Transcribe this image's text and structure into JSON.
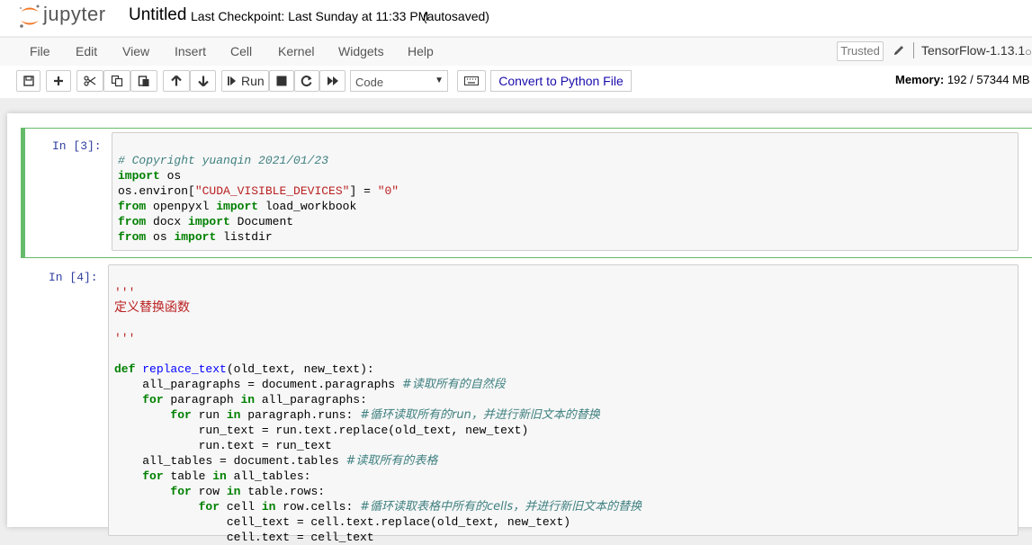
{
  "header": {
    "logo_text": "jupyter",
    "title": "Untitled",
    "checkpoint": "Last Checkpoint: Last Sunday at 11:33 PM",
    "autosave": "(autosaved)"
  },
  "menu": [
    "File",
    "Edit",
    "View",
    "Insert",
    "Cell",
    "Kernel",
    "Widgets",
    "Help"
  ],
  "trusted_label": "Trusted",
  "kernel_name": "TensorFlow-1.13.1",
  "toolbar": {
    "run_label": "Run",
    "cell_type": "Code",
    "convert_label": "Convert to Python File",
    "memory_label": "Memory:",
    "memory_value": "192 / 57344 MB"
  },
  "cells": [
    {
      "prompt": "In  [3]:",
      "lines": [
        "# Copyright yuanqin 2021/01/23",
        "import os",
        "os.environ[\"CUDA_VISIBLE_DEVICES\"] = \"0\"",
        "from openpyxl import load_workbook",
        "from docx import Document",
        "from os import listdir"
      ]
    },
    {
      "prompt": "In  [4]:",
      "lines": [
        "'''",
        "定义替换函数",
        "'''",
        "def replace_text(old_text, new_text):",
        "    all_paragraphs = document.paragraphs #读取所有的自然段",
        "    for paragraph in all_paragraphs:",
        "        for run in paragraph.runs: #循环读取所有的run，并进行新旧文本的替换",
        "            run_text = run.text.replace(old_text, new_text)",
        "            run.text = run_text",
        "    all_tables = document.tables #读取所有的表格",
        "    for table in all_tables:",
        "        for row in table.rows:",
        "            for cell in row.cells: #循环读取表格中所有的cells，并进行新旧文本的替换",
        "                cell_text = cell.text.replace(old_text, new_text)",
        "                cell.text = cell_text"
      ]
    }
  ]
}
